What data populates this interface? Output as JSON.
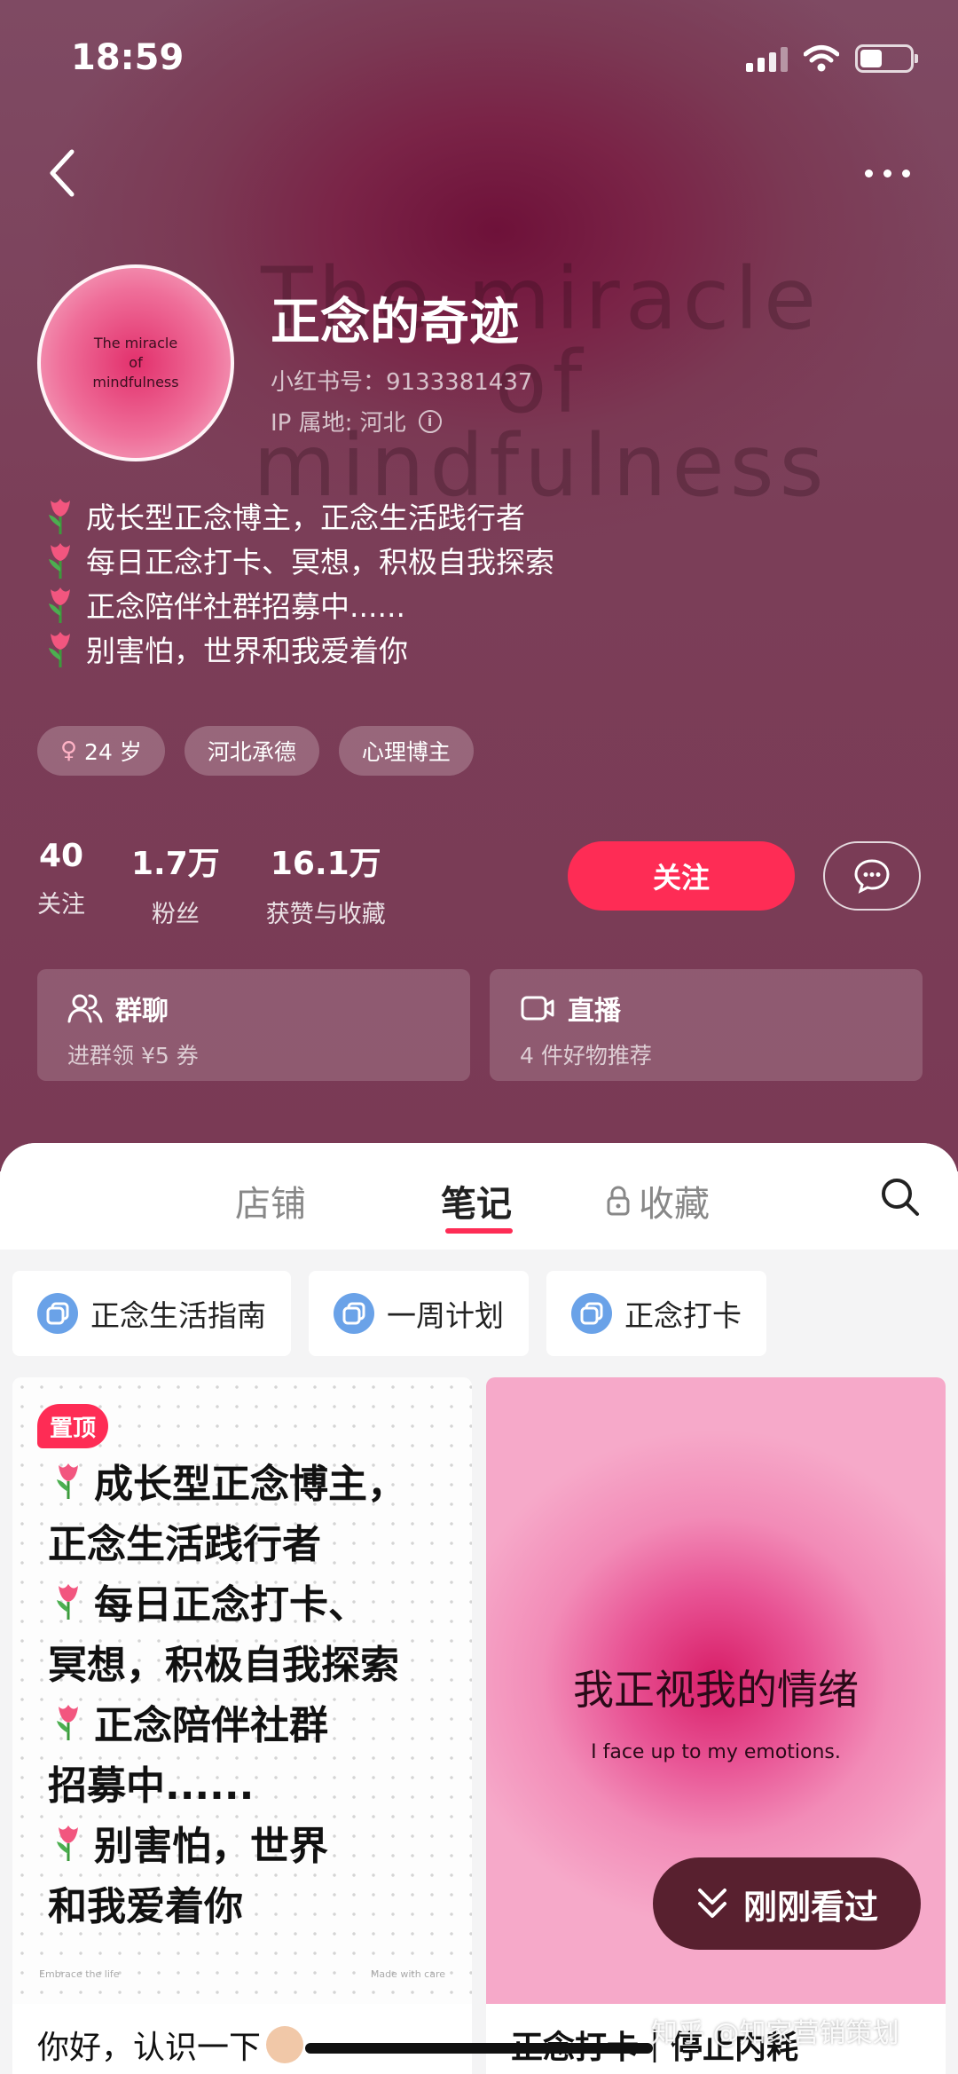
{
  "status_bar": {
    "time": "18:59"
  },
  "hero": {
    "watermark_lines": [
      "The miracle",
      "of",
      "mindfulness"
    ],
    "avatar_lines": [
      "The miracle",
      "of",
      "mindfulness"
    ],
    "nickname": "正念的奇迹",
    "red_id": "小红书号：9133381437",
    "ip_location": "IP 属地: 河北",
    "bio": [
      "成长型正念博主，正念生活践行者",
      "每日正念打卡、冥想，积极自我探索",
      "正念陪伴社群招募中......",
      "别害怕，世界和我爱着你"
    ],
    "tags": [
      {
        "icon": "female-icon",
        "label": "24 岁"
      },
      {
        "label": "河北承德"
      },
      {
        "label": "心理博主"
      }
    ],
    "stats": [
      {
        "value": "40",
        "label": "关注"
      },
      {
        "value": "1.7万",
        "label": "粉丝"
      },
      {
        "value": "16.1万",
        "label": "获赞与收藏"
      }
    ],
    "follow_label": "关注",
    "features": [
      {
        "icon": "group-chat-icon",
        "title": "群聊",
        "sub": "进群领 ¥5 券"
      },
      {
        "icon": "live-icon",
        "title": "直播",
        "sub": "4 件好物推荐"
      }
    ]
  },
  "tabs": {
    "shop": "店铺",
    "notes": "笔记",
    "favorites": "收藏"
  },
  "collections": [
    "正念生活指南",
    "一周计划",
    "正念打卡"
  ],
  "notes": {
    "left": {
      "badge": "置顶",
      "lines": [
        "成长型正念博主，",
        "正念生活践行者",
        "每日正念打卡、",
        "冥想，积极自我探索",
        "正念陪伴社群",
        "招募中......",
        "别害怕，世界",
        "和我爱着你"
      ],
      "foot_left": "Embrace the life",
      "foot_right": "Made with care",
      "title": "你好，认识一下"
    },
    "right": {
      "main_text": "我正视我的情绪",
      "sub_text": "I face up to my emotions.",
      "title": "正念打卡｜停止内耗"
    }
  },
  "recent_label": "刚刚看过",
  "site_watermark": "知乎 @知家营销策划",
  "colors": {
    "accent": "#fe2c55",
    "hero_bg": "#7b3e58"
  }
}
